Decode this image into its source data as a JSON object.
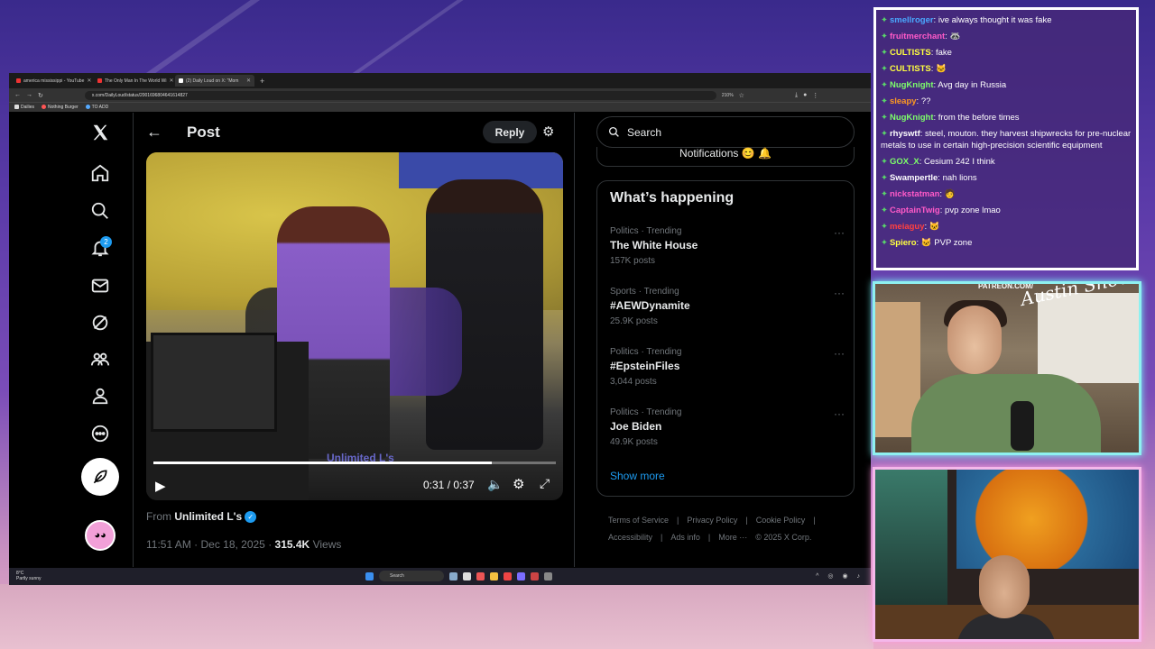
{
  "browser": {
    "tabs": [
      {
        "label": "america mississippi - YouTube"
      },
      {
        "label": "The Only Man In The World Wi"
      },
      {
        "label": "(2) Daily Loud on X: \"Mom"
      }
    ],
    "url": "x.com/DailyLoud/status/2001696804641614827",
    "zoom": "210%",
    "bookmarks": [
      "Dailies",
      "Nothing Burger",
      "TO ADD"
    ]
  },
  "x": {
    "badge_count": "2",
    "header": {
      "title": "Post",
      "reply_label": "Reply"
    },
    "video": {
      "time": "0:31 / 0:37",
      "progress": 0.84,
      "watermark": "Unlimited L's"
    },
    "from_prefix": "From",
    "from_name": "Unlimited L's",
    "meta_time": "11:51 AM · Dec 18, 2025 · ",
    "meta_views": "315.4K",
    "meta_views_suffix": " Views",
    "search_placeholder": "Search",
    "notif_stub": "Notifications 😊 🔔",
    "trends_title": "What’s happening",
    "trends": [
      {
        "cat": "Politics · Trending",
        "name": "The White House",
        "posts": "157K posts"
      },
      {
        "cat": "Sports · Trending",
        "name": "#AEWDynamite",
        "posts": "25.9K posts"
      },
      {
        "cat": "Politics · Trending",
        "name": "#EpsteinFiles",
        "posts": "3,044 posts"
      },
      {
        "cat": "Politics · Trending",
        "name": "Joe Biden",
        "posts": "49.9K posts"
      }
    ],
    "show_more": "Show more",
    "footer": [
      "Terms of Service",
      "|",
      "Privacy Policy",
      "|",
      "Cookie Policy",
      "|",
      "Accessibility",
      "|",
      "Ads info",
      "|",
      "More ···",
      "© 2025 X Corp."
    ]
  },
  "taskbar": {
    "weather_temp": "8°C",
    "weather_desc": "Partly sunny",
    "search": "Search"
  },
  "chat": [
    {
      "user": "smellroger",
      "color": "#4aa8ff",
      "msg": "ive always thought it was fake"
    },
    {
      "user": "fruitmerchant",
      "color": "#ff5ac8",
      "msg": "🦝"
    },
    {
      "user": "CULTISTS",
      "color": "#ffff40",
      "msg": "fake"
    },
    {
      "user": "CULTISTS",
      "color": "#ffff40",
      "msg": "🐱"
    },
    {
      "user": "NugKnight",
      "color": "#7dff6a",
      "msg": "Avg day in Russia"
    },
    {
      "user": "sleapy",
      "color": "#ff9a20",
      "msg": "??"
    },
    {
      "user": "NugKnight",
      "color": "#7dff6a",
      "msg": "from the before times"
    },
    {
      "user": "rhyswtf",
      "color": "#ffffff",
      "msg": "steel, mouton. they harvest shipwrecks for pre-nuclear metals to use in certain high-precision scientific equipment",
      "wrap": true
    },
    {
      "user": "GOX_X",
      "color": "#7dff6a",
      "msg": "Cesium 242 I think"
    },
    {
      "user": "Swampertle",
      "color": "#ffffff",
      "msg": "nah lions"
    },
    {
      "user": "nickstatman",
      "color": "#ff5ac8",
      "msg": "🧑"
    },
    {
      "user": "CaptainTwig",
      "color": "#ff5ac8",
      "msg": "pvp zone lmao"
    },
    {
      "user": "meiaguy",
      "color": "#ff4040",
      "msg": "🐱"
    },
    {
      "user": "Spiero",
      "color": "#ffff40",
      "msg": "🐱 PVP zone"
    }
  ],
  "cam": {
    "logo": "PATREON.COM/",
    "script": "Austin Show"
  }
}
